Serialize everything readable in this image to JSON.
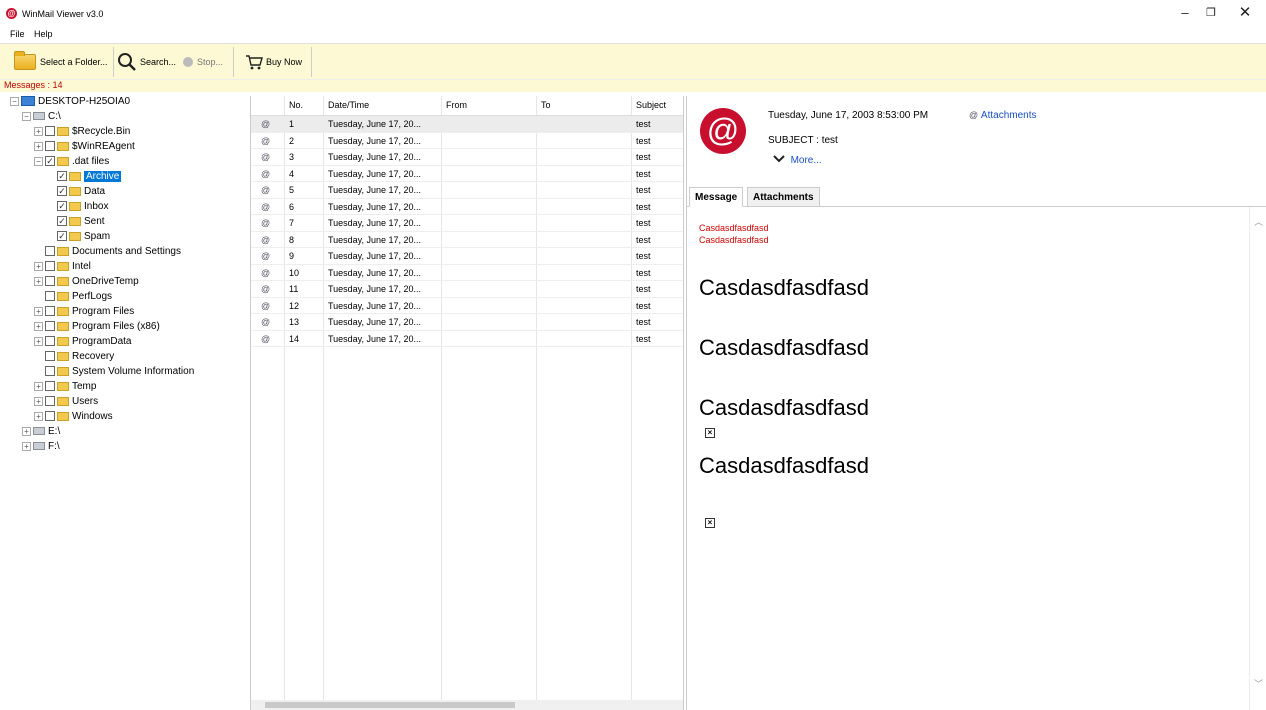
{
  "window": {
    "title": "WinMail Viewer v3.0",
    "controls": {
      "minimize": "–",
      "maximize": "❐",
      "close": "✕"
    }
  },
  "menu": {
    "file": "File",
    "help": "Help"
  },
  "toolbar": {
    "select_folder": "Select a Folder...",
    "search": "Search...",
    "stop": "Stop...",
    "buy_now": "Buy Now"
  },
  "status": {
    "messages": "Messages : 14"
  },
  "tree": {
    "root": "DESKTOP-H25OIA0",
    "drive_c": "C:\\",
    "recycle": "$Recycle.Bin",
    "winre": "$WinREAgent",
    "datfiles": ".dat files",
    "archive": "Archive",
    "data": "Data",
    "inbox": "Inbox",
    "sent": "Sent",
    "spam": "Spam",
    "docs": "Documents and Settings",
    "intel": "Intel",
    "onedrive": "OneDriveTemp",
    "perflogs": "PerfLogs",
    "progfiles": "Program Files",
    "progfiles86": "Program Files (x86)",
    "progdata": "ProgramData",
    "recovery": "Recovery",
    "sysvol": "System Volume Information",
    "temp": "Temp",
    "users": "Users",
    "windows": "Windows",
    "drive_e": "E:\\",
    "drive_f": "F:\\"
  },
  "list": {
    "headers": {
      "no": "No.",
      "datetime": "Date/Time",
      "from": "From",
      "to": "To",
      "subject": "Subject"
    },
    "rows": [
      {
        "no": "1",
        "date": "Tuesday, June 17, 20...",
        "subject": "test"
      },
      {
        "no": "2",
        "date": "Tuesday, June 17, 20...",
        "subject": "test"
      },
      {
        "no": "3",
        "date": "Tuesday, June 17, 20...",
        "subject": "test"
      },
      {
        "no": "4",
        "date": "Tuesday, June 17, 20...",
        "subject": "test"
      },
      {
        "no": "5",
        "date": "Tuesday, June 17, 20...",
        "subject": "test"
      },
      {
        "no": "6",
        "date": "Tuesday, June 17, 20...",
        "subject": "test"
      },
      {
        "no": "7",
        "date": "Tuesday, June 17, 20...",
        "subject": "test"
      },
      {
        "no": "8",
        "date": "Tuesday, June 17, 20...",
        "subject": "test"
      },
      {
        "no": "9",
        "date": "Tuesday, June 17, 20...",
        "subject": "test"
      },
      {
        "no": "10",
        "date": "Tuesday, June 17, 20...",
        "subject": "test"
      },
      {
        "no": "11",
        "date": "Tuesday, June 17, 20...",
        "subject": "test"
      },
      {
        "no": "12",
        "date": "Tuesday, June 17, 20...",
        "subject": "test"
      },
      {
        "no": "13",
        "date": "Tuesday, June 17, 20...",
        "subject": "test"
      },
      {
        "no": "14",
        "date": "Tuesday, June 17, 20...",
        "subject": "test"
      }
    ]
  },
  "preview": {
    "date": "Tuesday, June 17, 2003 8:53:00 PM",
    "attachments_link": "Attachments",
    "subject": "SUBJECT : test",
    "more": "More...",
    "tab_message": "Message",
    "tab_attachments": "Attachments",
    "red_line_1": "Casdasdfasdfasd",
    "red_line_2": "Casdasdfasdfasd",
    "big_1": "Casdasdfasdfasd",
    "big_2": "Casdasdfasdfasd",
    "big_3": "Casdasdfasdfasd",
    "big_4": "Casdasdfasdfasd"
  },
  "colors": {
    "toolbar_bg": "#fdf9d5",
    "accent_red": "#c8102e",
    "selection": "#0078d7",
    "link": "#1a4fc4"
  }
}
